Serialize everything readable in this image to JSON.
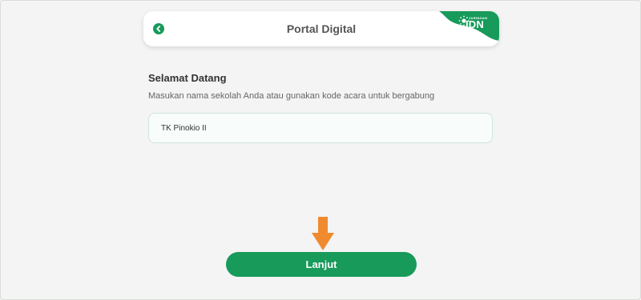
{
  "header": {
    "title": "Portal Digital",
    "back_icon": "chevron-left-icon",
    "brand": {
      "small_text": "JARINGAN",
      "big_text": "IDN",
      "icon": "sun-dots-icon",
      "color": "#179a5a"
    }
  },
  "main": {
    "heading": "Selamat Datang",
    "subtitle": "Masukan nama sekolah Anda atau gunakan kode acara untuk bergabung",
    "school_input": {
      "value": "TK Pinokio II"
    }
  },
  "annotation": {
    "arrow_icon": "arrow-down-icon",
    "color": "#f08a2e"
  },
  "footer": {
    "next_label": "Lanjut"
  },
  "colors": {
    "accent": "#179a5a",
    "background": "#f3f4f3"
  }
}
